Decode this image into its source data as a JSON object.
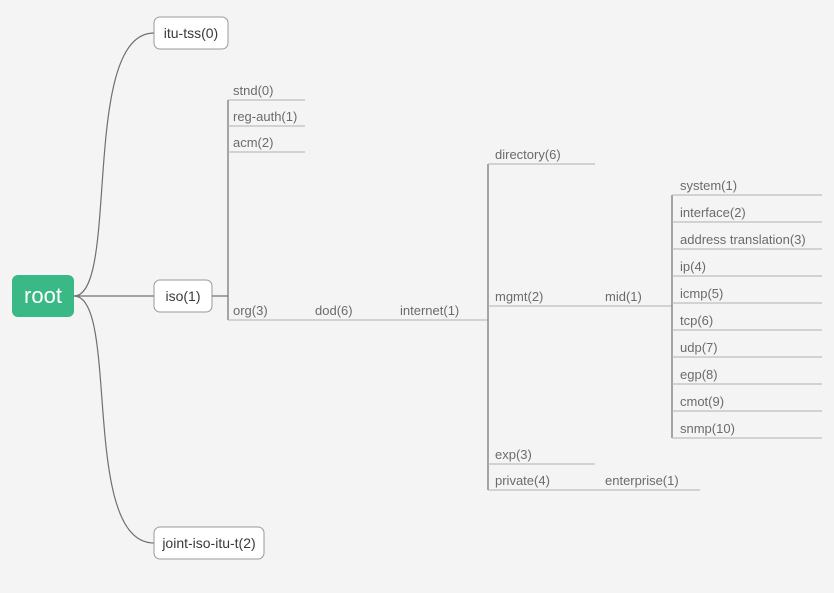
{
  "root": {
    "label": "root"
  },
  "top_branches": [
    {
      "label": "itu-tss(0)"
    },
    {
      "label": "iso(1)"
    },
    {
      "label": "joint-iso-itu-t(2)"
    }
  ],
  "iso_children_top": [
    {
      "label": "stnd(0)"
    },
    {
      "label": "reg-auth(1)"
    },
    {
      "label": "acm(2)"
    }
  ],
  "iso_path": [
    {
      "label": "org(3)"
    },
    {
      "label": "dod(6)"
    },
    {
      "label": "internet(1)"
    }
  ],
  "internet_children": [
    {
      "label": "directory(6)"
    },
    {
      "label": "mgmt(2)"
    },
    {
      "label": "exp(3)"
    },
    {
      "label": "private(4)"
    }
  ],
  "mgmt_path": [
    {
      "label": "mid(1)"
    }
  ],
  "mid_children": [
    {
      "label": "system(1)"
    },
    {
      "label": "interface(2)"
    },
    {
      "label": "address translation(3)"
    },
    {
      "label": "ip(4)"
    },
    {
      "label": "icmp(5)"
    },
    {
      "label": "tcp(6)"
    },
    {
      "label": "udp(7)"
    },
    {
      "label": "egp(8)"
    },
    {
      "label": "cmot(9)"
    },
    {
      "label": "snmp(10)"
    }
  ],
  "private_children": [
    {
      "label": "enterprise(1)"
    }
  ],
  "chart_data": {
    "type": "tree",
    "title": "OID tree",
    "root": {
      "name": "root",
      "children": [
        {
          "name": "itu-tss",
          "id": 0
        },
        {
          "name": "iso",
          "id": 1,
          "children": [
            {
              "name": "stnd",
              "id": 0
            },
            {
              "name": "reg-auth",
              "id": 1
            },
            {
              "name": "acm",
              "id": 2
            },
            {
              "name": "org",
              "id": 3,
              "children": [
                {
                  "name": "dod",
                  "id": 6,
                  "children": [
                    {
                      "name": "internet",
                      "id": 1,
                      "children": [
                        {
                          "name": "directory",
                          "id": 6
                        },
                        {
                          "name": "mgmt",
                          "id": 2,
                          "children": [
                            {
                              "name": "mid",
                              "id": 1,
                              "children": [
                                {
                                  "name": "system",
                                  "id": 1
                                },
                                {
                                  "name": "interface",
                                  "id": 2
                                },
                                {
                                  "name": "address translation",
                                  "id": 3
                                },
                                {
                                  "name": "ip",
                                  "id": 4
                                },
                                {
                                  "name": "icmp",
                                  "id": 5
                                },
                                {
                                  "name": "tcp",
                                  "id": 6
                                },
                                {
                                  "name": "udp",
                                  "id": 7
                                },
                                {
                                  "name": "egp",
                                  "id": 8
                                },
                                {
                                  "name": "cmot",
                                  "id": 9
                                },
                                {
                                  "name": "snmp",
                                  "id": 10
                                }
                              ]
                            }
                          ]
                        },
                        {
                          "name": "exp",
                          "id": 3
                        },
                        {
                          "name": "private",
                          "id": 4,
                          "children": [
                            {
                              "name": "enterprise",
                              "id": 1
                            }
                          ]
                        }
                      ]
                    }
                  ]
                }
              ]
            }
          ]
        },
        {
          "name": "joint-iso-itu-t",
          "id": 2
        }
      ]
    }
  }
}
